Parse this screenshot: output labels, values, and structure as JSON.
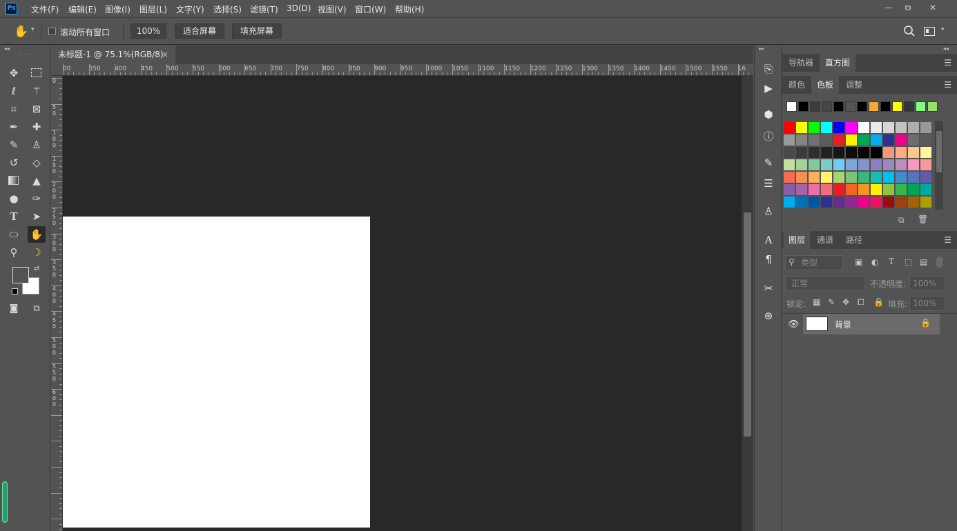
{
  "app": {
    "logo": "Ps"
  },
  "menu": [
    "文件(F)",
    "编辑(E)",
    "图像(I)",
    "图层(L)",
    "文字(Y)",
    "选择(S)",
    "滤镜(T)",
    "3D(D)",
    "视图(V)",
    "窗口(W)",
    "帮助(H)"
  ],
  "window_controls": {
    "minimize": "—",
    "restore": "⧉",
    "close": "✕"
  },
  "options": {
    "scroll_all_label": "滚动所有窗口",
    "zoom_100": "100%",
    "fit_screen": "适合屏幕",
    "fill_screen": "填充屏幕"
  },
  "document": {
    "tab_title": "未标题-1 @ 75.1%(RGB/8)",
    "tab_close": "×",
    "ruler_h_ticks": [
      "00",
      "350",
      "400",
      "450",
      "500",
      "550",
      "600",
      "650",
      "700",
      "750",
      "800",
      "850",
      "900",
      "950",
      "1000",
      "1050",
      "1100",
      "1150",
      "1200",
      "1250",
      "1300",
      "1350",
      "1400",
      "1450",
      "1500",
      "1550",
      "16"
    ],
    "ruler_v_ticks": [
      "0",
      "5\n0",
      "1\n0\n0",
      "1\n5\n0",
      "2\n0\n0",
      "2\n5\n0",
      "3\n0\n0",
      "3\n5\n0",
      "4\n0\n0",
      "4\n5\n0",
      "5\n0\n0",
      "5\n5\n0",
      "6\n0\n0"
    ]
  },
  "panels": {
    "top_tabs": [
      "导航器",
      "直方图"
    ],
    "top_active": "直方图",
    "color_tabs": [
      "颜色",
      "色板",
      "调整"
    ],
    "color_active": "色板",
    "recent_swatches": [
      "#ffffff",
      "#000000",
      "#3c3c3c",
      "#464646",
      "#000000",
      "#555555",
      "#000000",
      "#f7a934",
      "#000000",
      "#ffff00",
      "#333333",
      "#80ff80",
      "#99e06a"
    ],
    "swatch_grid": [
      [
        "#ff0000",
        "#ffff00",
        "#00ff00",
        "#00ffff",
        "#0000ff",
        "#ff00ff",
        "#ffffff",
        "#ebebeb",
        "#d6d6d6",
        "#c2c2c2",
        "#adadad",
        "#999999"
      ],
      [
        "#999999",
        "#858585",
        "#707070",
        "#5c5c5c",
        "#ed1c24",
        "#fff200",
        "#00a651",
        "#00aeef",
        "#2e3192",
        "#ec008c",
        "#6d6d6d",
        "#5a5a5a"
      ],
      [
        "#4a4a4a",
        "#3b3b3b",
        "#2e2e2e",
        "#222222",
        "#171717",
        "#0d0d0d",
        "#050505",
        "#000000",
        "#f7977a",
        "#fbad82",
        "#fdc68c",
        "#fff799"
      ],
      [
        "#c4df9b",
        "#a3d39c",
        "#82ca9c",
        "#7accc8",
        "#6dcff6",
        "#7ea7d8",
        "#8493ca",
        "#8882be",
        "#a187be",
        "#bc8dbf",
        "#f49ac2",
        "#f6989d"
      ],
      [
        "#f26c4f",
        "#f68e55",
        "#fbaf5c",
        "#fff467",
        "#acd372",
        "#7cc576",
        "#3bb878",
        "#1abbb4",
        "#00bff3",
        "#438ccb",
        "#5574b9",
        "#605ca8"
      ],
      [
        "#855fa8",
        "#a763a9",
        "#ef6ea8",
        "#f16d7e",
        "#ed1c24",
        "#f26522",
        "#f7941d",
        "#fff200",
        "#8dc63f",
        "#39b54a",
        "#00a651",
        "#00a99d"
      ],
      [
        "#00aeef",
        "#0072bc",
        "#0054a6",
        "#2e3192",
        "#662d91",
        "#92278f",
        "#ec008c",
        "#ed145b",
        "#9e0b0f",
        "#a0410d",
        "#a36209",
        "#aba000"
      ]
    ],
    "layer_tabs": [
      "图层",
      "通道",
      "路径"
    ],
    "layer_active": "图层",
    "kind_placeholder": "类型",
    "blend_mode": "正常",
    "opacity_label": "不透明度:",
    "opacity_value": "100%",
    "lock_label": "锁定:",
    "fill_label": "填充:",
    "fill_value": "100%",
    "layers": [
      {
        "name": "背景",
        "visible": true,
        "locked": true
      }
    ]
  },
  "colors": {
    "foreground": "#535353",
    "background": "#ffffff",
    "accent": "#31a8ff"
  }
}
